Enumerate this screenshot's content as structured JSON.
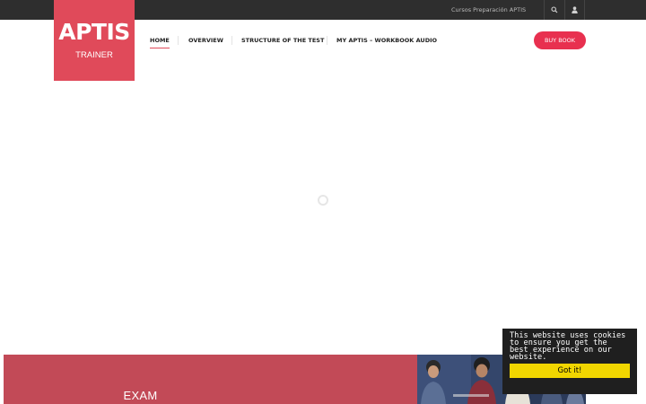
{
  "topbar": {
    "link_label": "Cursos Preparación APTIS",
    "search_icon": "search-icon",
    "user_icon": "user-icon"
  },
  "logo": {
    "title": "APTIS",
    "subtitle": "TRAINER",
    "color": "#e04a5a"
  },
  "nav": {
    "items": [
      {
        "label": "HOME",
        "active": true
      },
      {
        "label": "OVERVIEW",
        "active": false
      },
      {
        "label": "STRUCTURE OF THE TEST",
        "active": false
      },
      {
        "label": "MY APTIS – WORKBOOK AUDIO",
        "active": false
      }
    ]
  },
  "header": {
    "buy_label": "BUY BOOK",
    "accent": "#e8304f"
  },
  "loader": {
    "icon": "loading-spinner-icon"
  },
  "banner": {
    "text": "EXAM",
    "color": "#c24a57"
  },
  "cookie": {
    "message": "This website uses cookies to ensure you get the best experience on our website.",
    "button_label": "Got it!",
    "button_color": "#f1d600"
  }
}
